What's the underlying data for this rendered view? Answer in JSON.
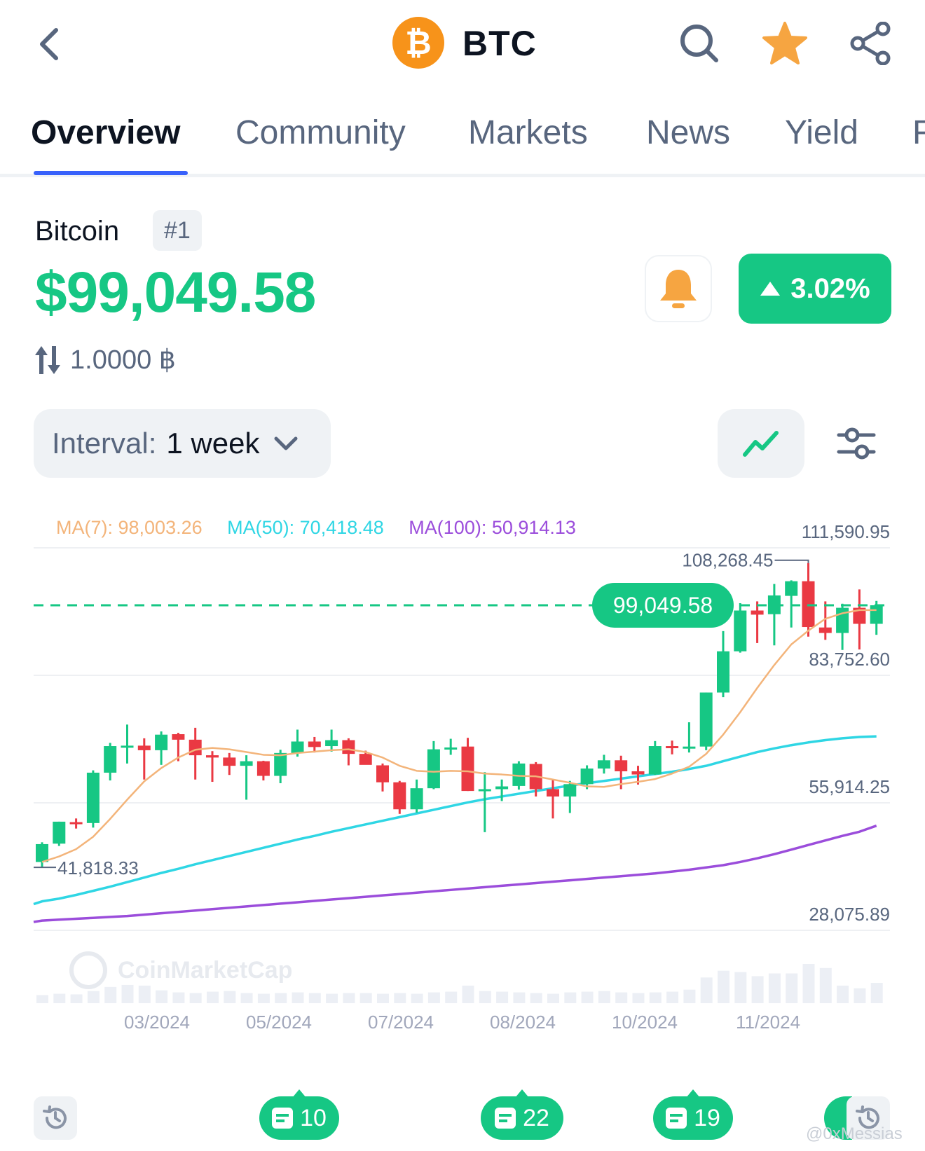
{
  "header": {
    "symbol": "BTC",
    "logo_glyph": "₿",
    "icons": [
      "back-chevron-icon",
      "search-icon",
      "star-icon",
      "share-icon"
    ],
    "star_color": "#f6a541",
    "logo_color": "#f7931a"
  },
  "tabs": [
    "Overview",
    "Community",
    "Markets",
    "News",
    "Yield",
    "F"
  ],
  "active_tab": "Overview",
  "coin": {
    "name": "Bitcoin",
    "rank": "#1",
    "price": "$99,049.58",
    "change": "3.02%",
    "change_direction": "up",
    "conversion": "1.0000 ฿"
  },
  "controls": {
    "interval_label": "Interval:",
    "interval_value": "1 week"
  },
  "colors": {
    "green": "#16c784",
    "red": "#ea3943",
    "ma7": "#f3b47a",
    "ma50": "#2fd6e4",
    "ma100": "#9b4ddb",
    "accent": "#3861fb"
  },
  "chart_data": {
    "type": "candlestick",
    "ma_labels": [
      "MA(7): 98,003.26",
      "MA(50): 70,418.48",
      "MA(100): 50,914.13"
    ],
    "y_ticks": [
      "111,590.95",
      "83,752.60",
      "55,914.25",
      "28,075.89"
    ],
    "y_tick_values": [
      111590.95,
      83752.6,
      55914.25,
      28075.89
    ],
    "x_ticks": [
      "03/2024",
      "05/2024",
      "07/2024",
      "08/2024",
      "10/2024",
      "11/2024"
    ],
    "current_price_label": "99,049.58",
    "current_price": 99049.58,
    "high_label": "108,268.45",
    "high_value": 108268.45,
    "low_label": "41,818.33",
    "low_value": 41818.33,
    "watermark": "CoinMarketCap",
    "candles": [
      [
        43000,
        47300,
        41818,
        46900
      ],
      [
        47000,
        51800,
        46500,
        51800
      ],
      [
        51700,
        52500,
        50300,
        51600
      ],
      [
        51500,
        63000,
        50500,
        62500
      ],
      [
        62500,
        69000,
        60800,
        68300
      ],
      [
        68300,
        73000,
        64500,
        68400
      ],
      [
        68400,
        70000,
        61000,
        67400
      ],
      [
        67400,
        71500,
        64200,
        70800
      ],
      [
        70900,
        71200,
        65000,
        69700
      ],
      [
        69700,
        72300,
        61000,
        66300
      ],
      [
        66300,
        67200,
        60500,
        65800
      ],
      [
        65800,
        66800,
        62000,
        64000
      ],
      [
        64000,
        66300,
        56600,
        65000
      ],
      [
        65000,
        65100,
        60800,
        61800
      ],
      [
        61800,
        67500,
        60200,
        66800
      ],
      [
        66800,
        71900,
        66000,
        69300
      ],
      [
        69300,
        70300,
        66900,
        68100
      ],
      [
        68300,
        71900,
        67100,
        69600
      ],
      [
        69600,
        70000,
        64100,
        66600
      ],
      [
        66600,
        67300,
        64400,
        64200
      ],
      [
        64100,
        64500,
        58400,
        60400
      ],
      [
        60400,
        60700,
        53500,
        54500
      ],
      [
        54500,
        61000,
        53800,
        59100
      ],
      [
        59100,
        69400,
        58900,
        67600
      ],
      [
        67600,
        69900,
        66400,
        68000
      ],
      [
        68200,
        70100,
        58500,
        58500
      ],
      [
        58500,
        62600,
        49500,
        58900
      ],
      [
        58900,
        61000,
        56300,
        59500
      ],
      [
        59600,
        65000,
        58800,
        64500
      ],
      [
        64400,
        64800,
        57300,
        58900
      ],
      [
        58900,
        61000,
        52500,
        57300
      ],
      [
        57300,
        60700,
        53700,
        60000
      ],
      [
        60000,
        64100,
        58900,
        63400
      ],
      [
        63400,
        66400,
        62300,
        65200
      ],
      [
        65200,
        66200,
        58900,
        62800
      ],
      [
        62800,
        64000,
        59900,
        62100
      ],
      [
        62100,
        69400,
        62000,
        68300
      ],
      [
        68300,
        69500,
        66500,
        67900
      ],
      [
        67900,
        73500,
        66900,
        68200
      ],
      [
        68200,
        80000,
        67400,
        80000
      ],
      [
        80000,
        93400,
        79000,
        89000
      ],
      [
        89000,
        99500,
        88700,
        97900
      ],
      [
        97900,
        99900,
        90800,
        97000
      ],
      [
        97100,
        103700,
        90300,
        101200
      ],
      [
        101100,
        104500,
        94200,
        104300
      ],
      [
        104300,
        108268,
        92200,
        94300
      ],
      [
        94200,
        99900,
        91500,
        93000
      ],
      [
        93000,
        99400,
        89300,
        98500
      ],
      [
        98500,
        102500,
        89400,
        95000
      ],
      [
        95000,
        100000,
        92600,
        99049
      ]
    ],
    "ma7": [
      43000,
      44200,
      45800,
      48500,
      52400,
      56600,
      60600,
      63500,
      65800,
      67500,
      67900,
      67600,
      67000,
      66400,
      66300,
      66800,
      67100,
      67400,
      67600,
      67000,
      65800,
      64000,
      62900,
      62700,
      62900,
      62800,
      62300,
      62100,
      61800,
      61700,
      61000,
      60300,
      59500,
      59400,
      60000,
      60500,
      61100,
      62300,
      63800,
      66600,
      70800,
      75700,
      81000,
      86000,
      90500,
      93500,
      96100,
      97300,
      98000,
      98000
    ],
    "ma50": [
      34400,
      35000,
      35800,
      36700,
      37600,
      38600,
      39600,
      40600,
      41500,
      42500,
      43400,
      44300,
      45200,
      46100,
      47000,
      47900,
      48700,
      49600,
      50400,
      51200,
      52000,
      52800,
      53600,
      54400,
      55200,
      56000,
      56700,
      57300,
      57900,
      58500,
      59100,
      59700,
      60200,
      60700,
      61200,
      61700,
      62200,
      62700,
      63300,
      64000,
      65000,
      66000,
      67000,
      67800,
      68500,
      69100,
      69600,
      70000,
      70300,
      70418
    ],
    "ma100": [
      30200,
      30400,
      30600,
      30800,
      31000,
      31200,
      31500,
      31800,
      32100,
      32400,
      32700,
      33000,
      33300,
      33600,
      33900,
      34200,
      34500,
      34800,
      35100,
      35400,
      35700,
      36000,
      36300,
      36600,
      36900,
      37200,
      37500,
      37800,
      38100,
      38400,
      38700,
      39000,
      39300,
      39600,
      39900,
      40200,
      40500,
      40900,
      41300,
      41800,
      42300,
      43000,
      43800,
      44700,
      45700,
      46700,
      47700,
      48700,
      49600,
      50914
    ],
    "volume": [
      12,
      14,
      13,
      18,
      24,
      27,
      26,
      19,
      16,
      15,
      17,
      18,
      15,
      14,
      15,
      16,
      15,
      14,
      15,
      15,
      14,
      15,
      14,
      16,
      17,
      26,
      18,
      17,
      16,
      15,
      14,
      16,
      17,
      18,
      16,
      15,
      16,
      17,
      20,
      38,
      48,
      46,
      40,
      44,
      44,
      58,
      52,
      26,
      22,
      30
    ]
  },
  "bottom_bar": {
    "news_counts": [
      "10",
      "22",
      "19"
    ]
  },
  "watermark_user": "@0xMessias"
}
